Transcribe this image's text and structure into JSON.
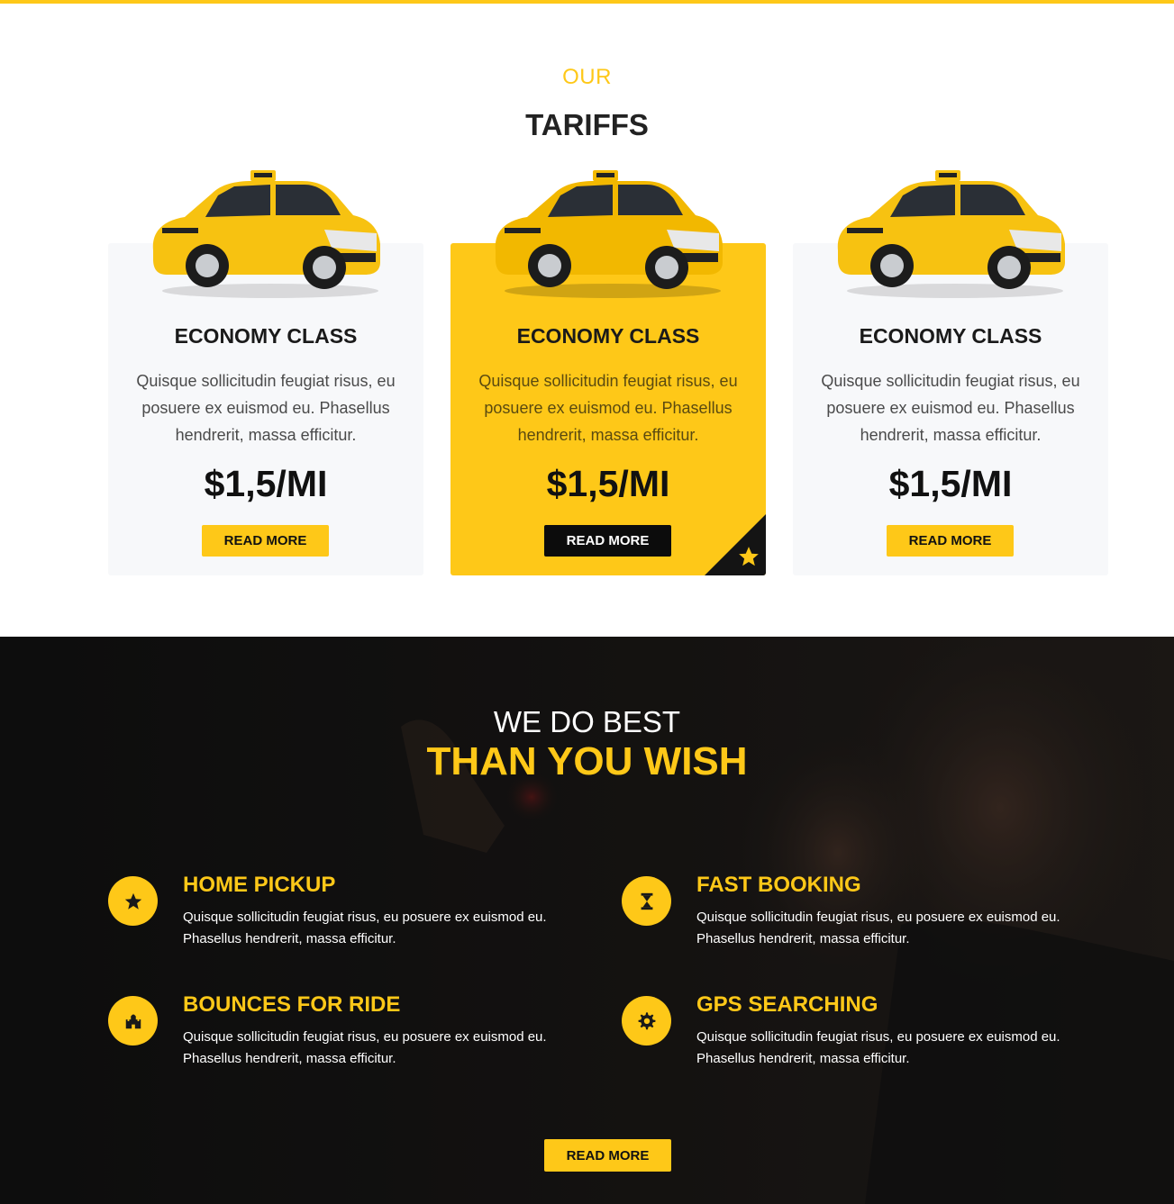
{
  "colors": {
    "accent": "#fec818",
    "dark": "#141414",
    "card_bg": "#f7f8fa"
  },
  "tariffs": {
    "kicker": "OUR",
    "title": "TARIFFS",
    "cards": [
      {
        "title": "ECONOMY CLASS",
        "text": "Quisque sollicitudin feugiat risus, eu posuere ex euismod eu. Phasellus hendrerit, massa efficitur.",
        "price": "$1,5/MI",
        "button": "READ MORE",
        "featured": false
      },
      {
        "title": "ECONOMY CLASS",
        "text": "Quisque sollicitudin feugiat risus, eu posuere ex euismod eu. Phasellus hendrerit, massa efficitur.",
        "price": "$1,5/MI",
        "button": "READ MORE",
        "featured": true,
        "badge_icon": "star-icon"
      },
      {
        "title": "ECONOMY CLASS",
        "text": "Quisque sollicitudin feugiat risus, eu posuere ex euismod eu. Phasellus hendrerit, massa efficitur.",
        "price": "$1,5/MI",
        "button": "READ MORE",
        "featured": false
      }
    ]
  },
  "features": {
    "kicker": "WE DO BEST",
    "title": "THAN YOU WISH",
    "items": [
      {
        "icon": "star-icon",
        "title": "HOME PICKUP",
        "text": "Quisque sollicitudin feugiat risus, eu posuere ex euismod eu. Phasellus hendrerit, massa efficitur."
      },
      {
        "icon": "hourglass-icon",
        "title": "FAST BOOKING",
        "text": "Quisque sollicitudin feugiat risus, eu posuere ex euismod eu. Phasellus hendrerit, massa efficitur."
      },
      {
        "icon": "castle-icon",
        "title": "BOUNCES FOR RIDE",
        "text": "Quisque sollicitudin feugiat risus, eu posuere ex euismod eu. Phasellus hendrerit, massa efficitur."
      },
      {
        "icon": "gear-icon",
        "title": "GPS SEARCHING",
        "text": "Quisque sollicitudin feugiat risus, eu posuere ex euismod eu. Phasellus hendrerit, massa efficitur."
      }
    ],
    "button": "READ MORE"
  }
}
